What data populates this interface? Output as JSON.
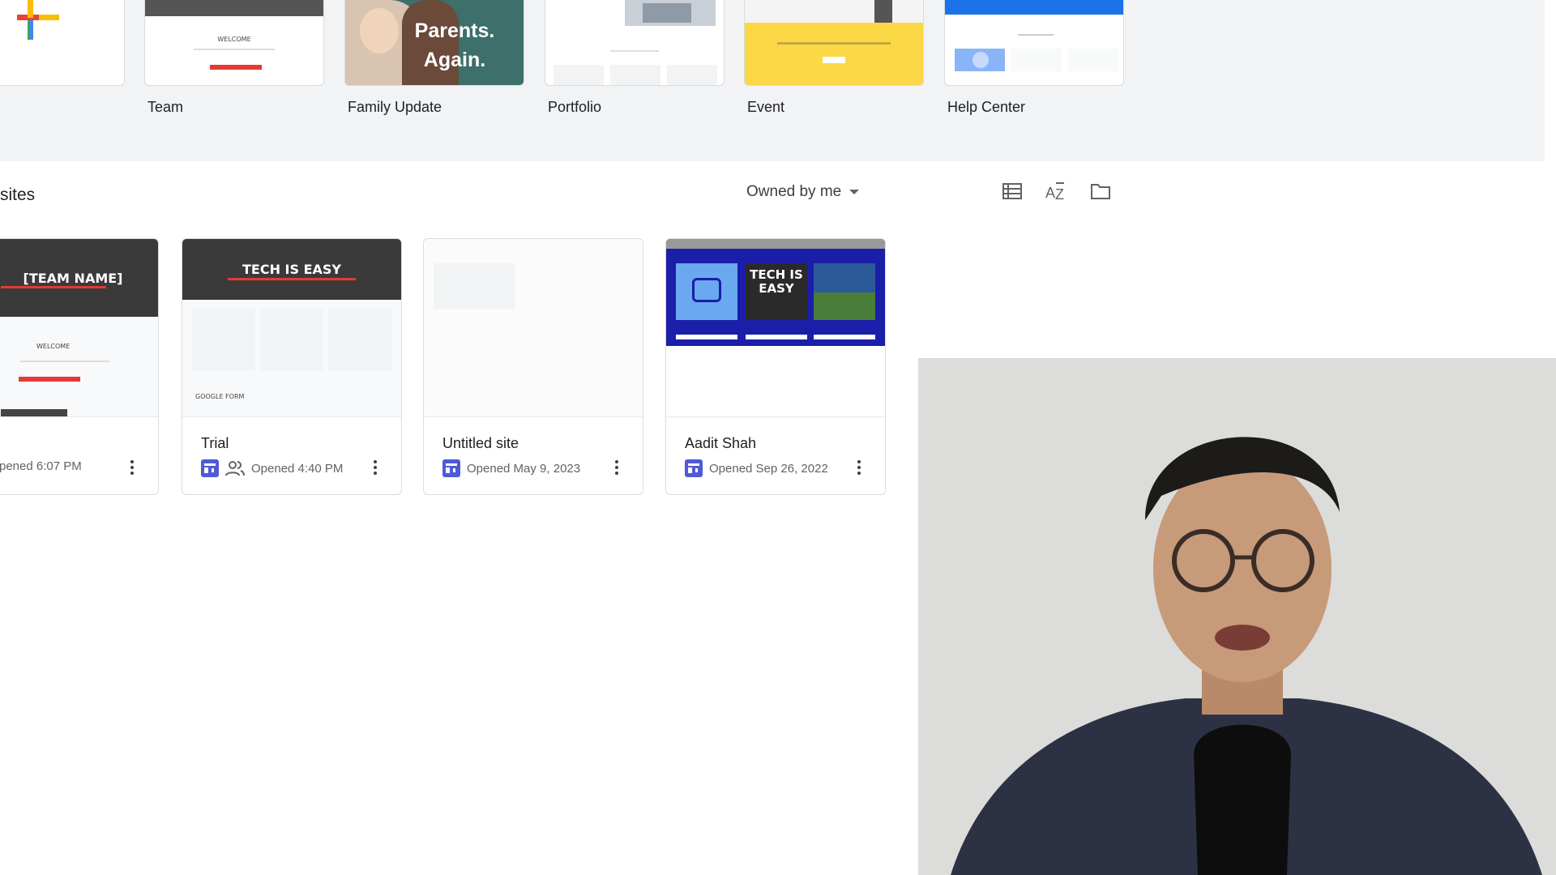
{
  "templates": [
    {
      "name": "Team"
    },
    {
      "name": "Family Update",
      "thumb_text_1": "Parents.",
      "thumb_text_2": "Again."
    },
    {
      "name": "Portfolio"
    },
    {
      "name": "Event"
    },
    {
      "name": "Help Center"
    }
  ],
  "team_template_thumb": {
    "heading": "WELCOME"
  },
  "recent": {
    "section_title": "sites",
    "owner_filter": "Owned by me",
    "tools": {
      "list_view_icon": "list-view-icon",
      "sort_icon": "sort-az-icon",
      "folder_icon": "folder-icon"
    }
  },
  "sites": [
    {
      "title": "",
      "opened": "pened 6:07 PM",
      "preview_heading": "[TEAM NAME]",
      "preview_sub": "WELCOME",
      "shared": false
    },
    {
      "title": "Trial",
      "opened": "Opened 4:40 PM",
      "preview_heading": "TECH IS EASY",
      "preview_sub": "GOOGLE FORM",
      "shared": true
    },
    {
      "title": "Untitled site",
      "opened": "Opened May 9, 2023",
      "shared": false
    },
    {
      "title": "Aadit Shah",
      "opened": "Opened Sep 26, 2022",
      "preview_tile": "TECH IS EASY",
      "shared": false
    }
  ],
  "colors": {
    "accent": "#4f5bd5",
    "gallery_bg": "#f1f3f4",
    "event_yellow": "#fcd846",
    "aadit_blue": "#1b1ea8",
    "help_blue": "#1a73e8"
  }
}
